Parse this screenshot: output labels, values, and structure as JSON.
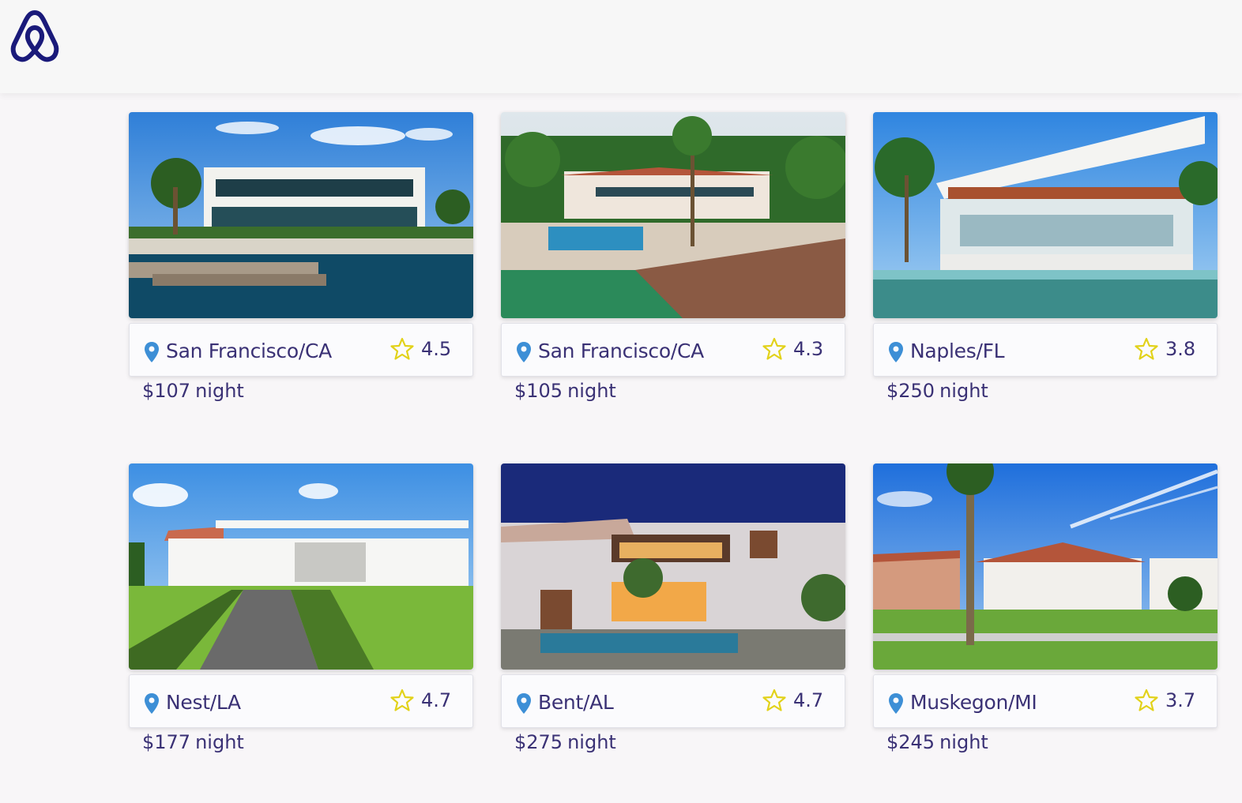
{
  "header": {
    "logo": "airbnb-logo"
  },
  "listings": [
    {
      "location": "San Francisco/CA",
      "rating": "4.5",
      "price": "$107",
      "price_unit": "night"
    },
    {
      "location": "San Francisco/CA",
      "rating": "4.3",
      "price": "$105",
      "price_unit": "night"
    },
    {
      "location": "Naples/FL",
      "rating": "3.8",
      "price": "$250",
      "price_unit": "night"
    },
    {
      "location": "Nest/LA",
      "rating": "4.7",
      "price": "$177",
      "price_unit": "night"
    },
    {
      "location": "Bent/AL",
      "rating": "4.7",
      "price": "$275",
      "price_unit": "night"
    },
    {
      "location": "Muskegon/MI",
      "rating": "3.7",
      "price": "$245",
      "price_unit": "night"
    }
  ],
  "icons": {
    "location": "location-pin-icon",
    "rating": "star-outline-icon"
  },
  "colors": {
    "text": "#3a3175",
    "pin": "#3d8fd6",
    "star": "#e2d21a",
    "logo": "#1a1a7a"
  }
}
